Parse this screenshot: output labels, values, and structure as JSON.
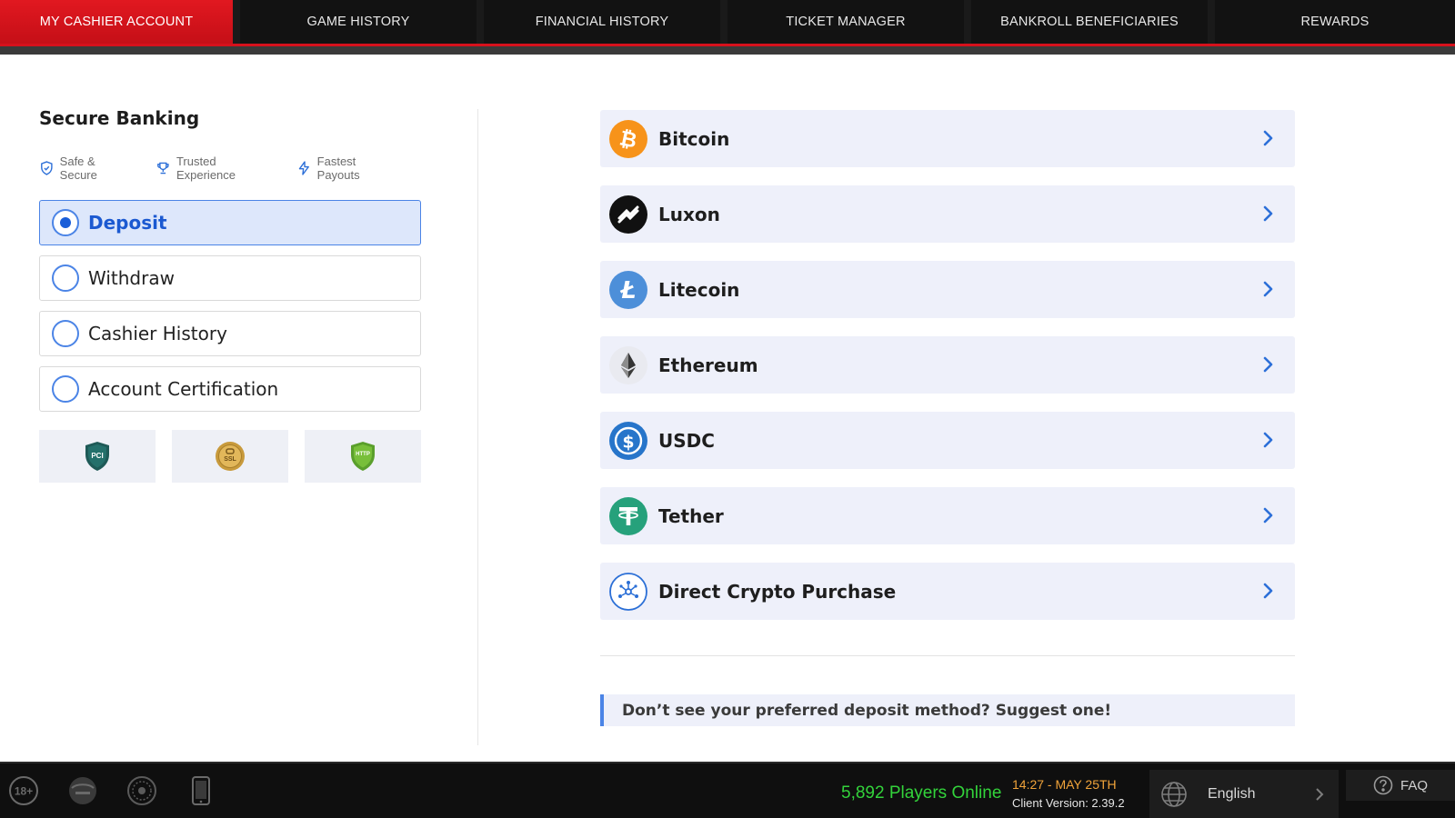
{
  "tabs": [
    {
      "label": "MY CASHIER ACCOUNT",
      "active": true
    },
    {
      "label": "GAME HISTORY"
    },
    {
      "label": "FINANCIAL HISTORY"
    },
    {
      "label": "TICKET MANAGER"
    },
    {
      "label": "BANKROLL BENEFICIARIES"
    },
    {
      "label": "REWARDS"
    }
  ],
  "banking": {
    "title": "Secure Banking",
    "badges": [
      {
        "label": "Safe & Secure",
        "icon": "shield-check-icon"
      },
      {
        "label": "Trusted Experience",
        "icon": "trophy-icon"
      },
      {
        "label": "Fastest Payouts",
        "icon": "lightning-icon"
      }
    ],
    "options": [
      {
        "label": "Deposit",
        "selected": true
      },
      {
        "label": "Withdraw",
        "selected": false
      },
      {
        "label": "Cashier History",
        "selected": false
      },
      {
        "label": "Account Certification",
        "selected": false
      }
    ],
    "seals": [
      {
        "icon": "pci-shield-icon",
        "text": "PCI"
      },
      {
        "icon": "ssl-seal-icon",
        "text": "SSL"
      },
      {
        "icon": "https-shield-icon",
        "text": "HTTP"
      }
    ]
  },
  "methods": [
    {
      "label": "Bitcoin",
      "icon": "bitcoin-icon",
      "color": "#f7931a"
    },
    {
      "label": "Luxon",
      "icon": "luxon-icon",
      "color": "#111111"
    },
    {
      "label": "Litecoin",
      "icon": "litecoin-icon",
      "color": "#345d9d"
    },
    {
      "label": "Ethereum",
      "icon": "ethereum-icon",
      "color": "#3c3c3d"
    },
    {
      "label": "USDC",
      "icon": "usdc-icon",
      "color": "#2775ca"
    },
    {
      "label": "Tether",
      "icon": "tether-icon",
      "color": "#26a17b"
    },
    {
      "label": "Direct Crypto Purchase",
      "icon": "crypto-network-icon",
      "color": "#2b6fd6"
    }
  ],
  "suggest": "Don’t see your preferred deposit method? Suggest one!",
  "footer": {
    "icons": [
      "age-18-plus-icon",
      "itech-labs-icon",
      "certification-seal-icon",
      "mobile-phone-icon"
    ],
    "age_text": "18+",
    "players_online": "5,892 Players Online",
    "clock": "14:27 - MAY 25TH",
    "version": "Client Version: 2.39.2",
    "language": "English",
    "faq": "FAQ"
  },
  "colors": {
    "accent_red": "#d6111c",
    "accent_blue": "#1b59d1",
    "players_green": "#33d33b",
    "clock_orange": "#f1a43a"
  }
}
